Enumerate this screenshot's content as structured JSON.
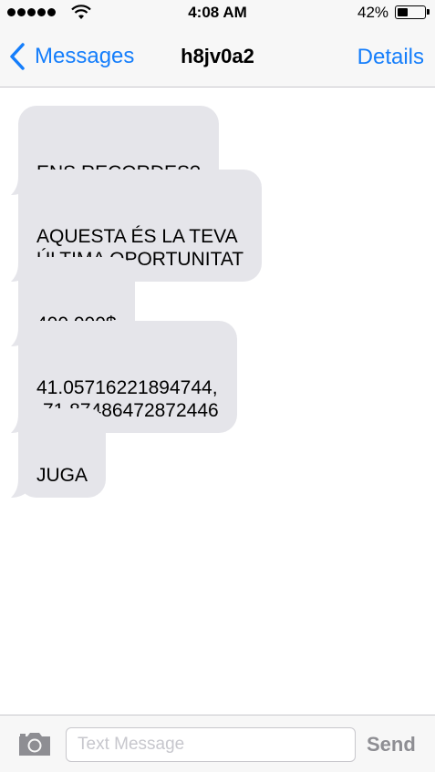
{
  "status_bar": {
    "time": "4:08 AM",
    "battery_percent": "42%",
    "battery_level": 0.42,
    "signal_bars": 5,
    "icons": [
      "signal-icon",
      "wifi-icon",
      "battery-icon"
    ]
  },
  "nav": {
    "back_label": "Messages",
    "title": "h8jv0a2",
    "details_label": "Details",
    "accent_color": "#157efb"
  },
  "messages": [
    {
      "text": "ENS RECORDES?"
    },
    {
      "text": "AQUESTA ÉS LA TEVA\nÚLTIMA OPORTUNITAT"
    },
    {
      "text": "400.000$"
    },
    {
      "text": "41.05716221894744,\n-71.87486472872446"
    },
    {
      "text": "JUGA"
    }
  ],
  "input_bar": {
    "placeholder": "Text Message",
    "value": "",
    "send_label": "Send",
    "camera_icon": "camera-icon"
  },
  "colors": {
    "bubble_incoming": "#e5e5ea",
    "bar_background": "#f7f7f7",
    "send_disabled": "#8e8e93"
  }
}
